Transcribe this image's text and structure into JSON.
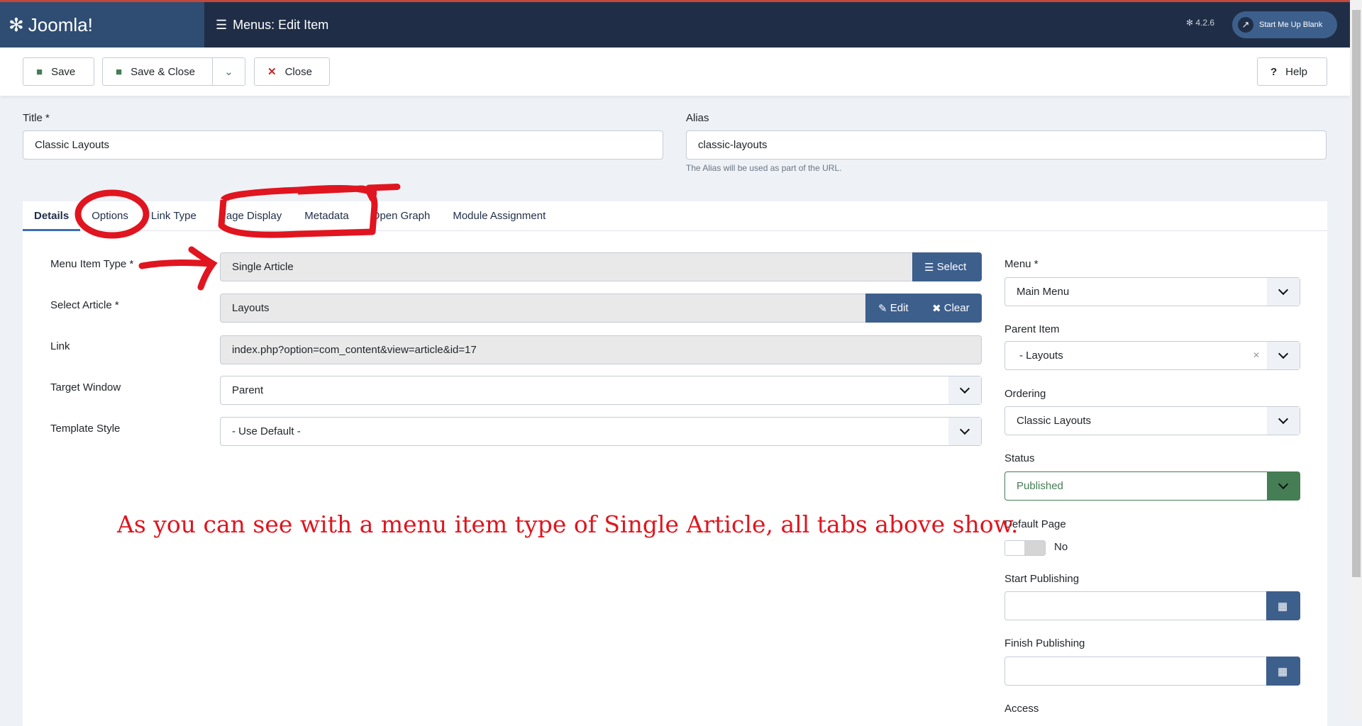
{
  "header": {
    "brand": "Joomla!",
    "title": "Menus: Edit Item",
    "version": "4.2.6",
    "site_button": "Start Me Up Blank"
  },
  "toolbar": {
    "save": "Save",
    "save_close": "Save & Close",
    "close": "Close",
    "help": "Help"
  },
  "form": {
    "title_label": "Title *",
    "title_value": "Classic Layouts",
    "alias_label": "Alias",
    "alias_value": "classic-layouts",
    "alias_help": "The Alias will be used as part of the URL."
  },
  "tabs": [
    "Details",
    "Options",
    "Link Type",
    "Page Display",
    "Metadata",
    "Open Graph",
    "Module Assignment"
  ],
  "details": {
    "menu_item_type_label": "Menu Item Type *",
    "menu_item_type_value": "Single Article",
    "select_btn": "Select",
    "select_article_label": "Select Article *",
    "select_article_value": "Layouts",
    "edit_btn": "Edit",
    "clear_btn": "Clear",
    "link_label": "Link",
    "link_value": "index.php?option=com_content&view=article&id=17",
    "target_label": "Target Window",
    "target_value": "Parent",
    "template_label": "Template Style",
    "template_value": "- Use Default -"
  },
  "side": {
    "menu_label": "Menu *",
    "menu_value": "Main Menu",
    "parent_label": "Parent Item",
    "parent_value": "- Layouts",
    "ordering_label": "Ordering",
    "ordering_value": "Classic Layouts",
    "status_label": "Status",
    "status_value": "Published",
    "default_label": "Default Page",
    "default_value": "No",
    "start_label": "Start Publishing",
    "finish_label": "Finish Publishing",
    "access_label": "Access"
  },
  "annotation": "As you can see with a menu item type of Single Article, all tabs above show.",
  "colors": {
    "header": "#1f2e46",
    "primary": "#3d5f8c",
    "success": "#457d54",
    "annotation": "#e0151f"
  }
}
